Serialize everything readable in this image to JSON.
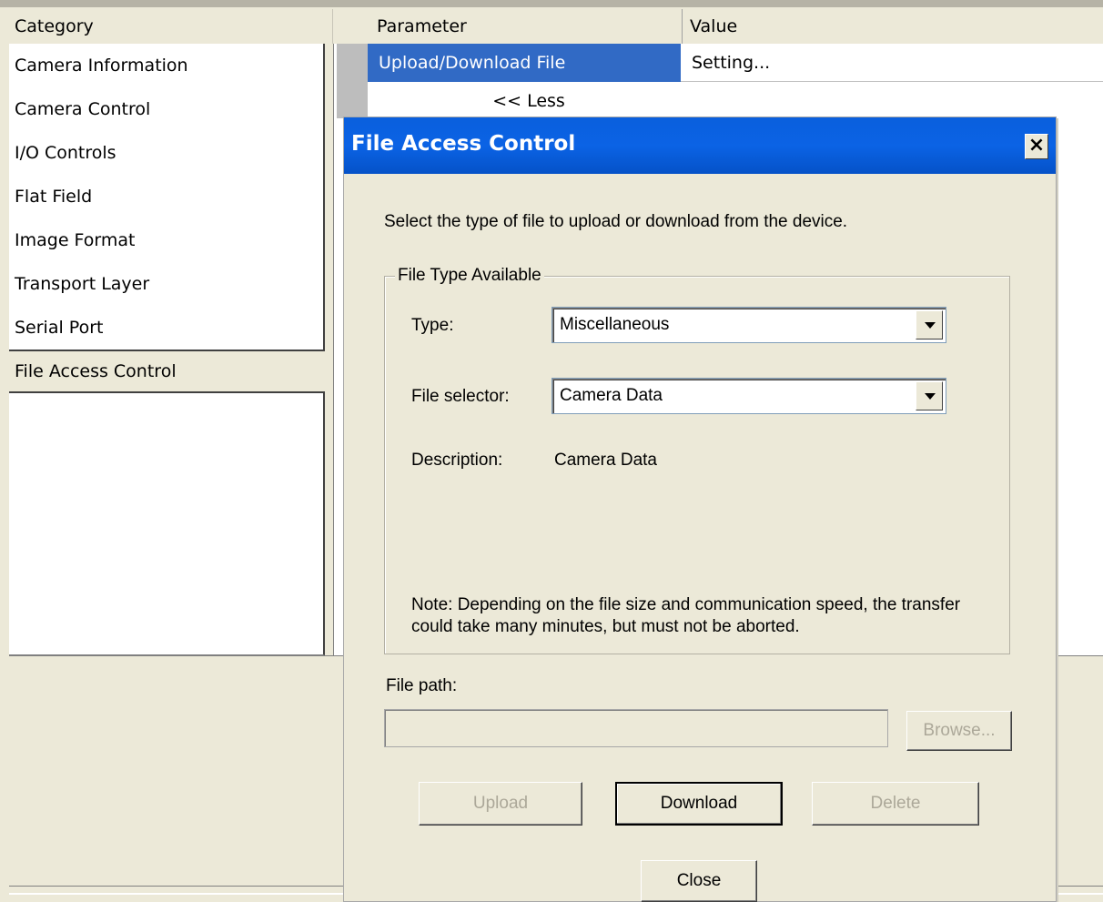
{
  "category_panel": {
    "header": "Category",
    "items": [
      {
        "label": "Camera Information"
      },
      {
        "label": "Camera Control"
      },
      {
        "label": "I/O Controls"
      },
      {
        "label": "Flat Field"
      },
      {
        "label": "Image Format"
      },
      {
        "label": "Transport Layer"
      },
      {
        "label": "Serial Port"
      },
      {
        "label": "File Access Control"
      }
    ],
    "selected": "File Access Control"
  },
  "parameter_grid": {
    "headers": {
      "parameter": "Parameter",
      "value": "Value"
    },
    "rows": [
      {
        "parameter": "Upload/Download File",
        "value": "Setting..."
      }
    ],
    "less_link": "<< Less"
  },
  "dialog": {
    "title": "File Access Control",
    "close_glyph": "×",
    "intro": "Select the type of file to upload or download from the device.",
    "group_label": "File Type Available",
    "type_label": "Type:",
    "type_value": "Miscellaneous",
    "selector_label": "File selector:",
    "selector_value": "Camera Data",
    "description_label": "Description:",
    "description_value": "Camera Data",
    "note": "Note: Depending on the file size and communication speed, the transfer could take many minutes, but must not be aborted.",
    "file_path_label": "File path:",
    "file_path_value": "",
    "buttons": {
      "browse": "Browse...",
      "upload": "Upload",
      "download": "Download",
      "delete": "Delete",
      "close": "Close"
    }
  },
  "colors": {
    "selection": "#316ac5",
    "titlebar": "#0b63e5",
    "window_bg": "#ece9d8"
  }
}
